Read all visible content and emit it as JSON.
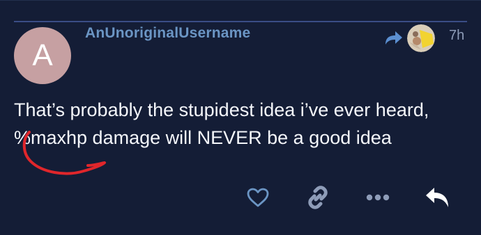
{
  "post": {
    "avatar_letter": "A",
    "username": "AnUnoriginalUsername",
    "time": "7h",
    "body_line1": "That’s probably the stupidest idea i’ve ever heard,",
    "body_line2": "%maxhp damage will NEVER be a good idea"
  },
  "icons": {
    "reply_to": "reply-to-arrow-icon",
    "like": "heart-icon",
    "link": "link-icon",
    "more": "ellipsis-icon",
    "reply": "reply-icon"
  },
  "colors": {
    "background": "#141d36",
    "divider": "#3a4d86",
    "avatar": "#c6a0a2",
    "username": "#6b95c4",
    "body_text": "#f4f6fa",
    "muted_icon": "#8e9cb8",
    "like_icon": "#6b95c4",
    "annotation": "#e0262b"
  }
}
